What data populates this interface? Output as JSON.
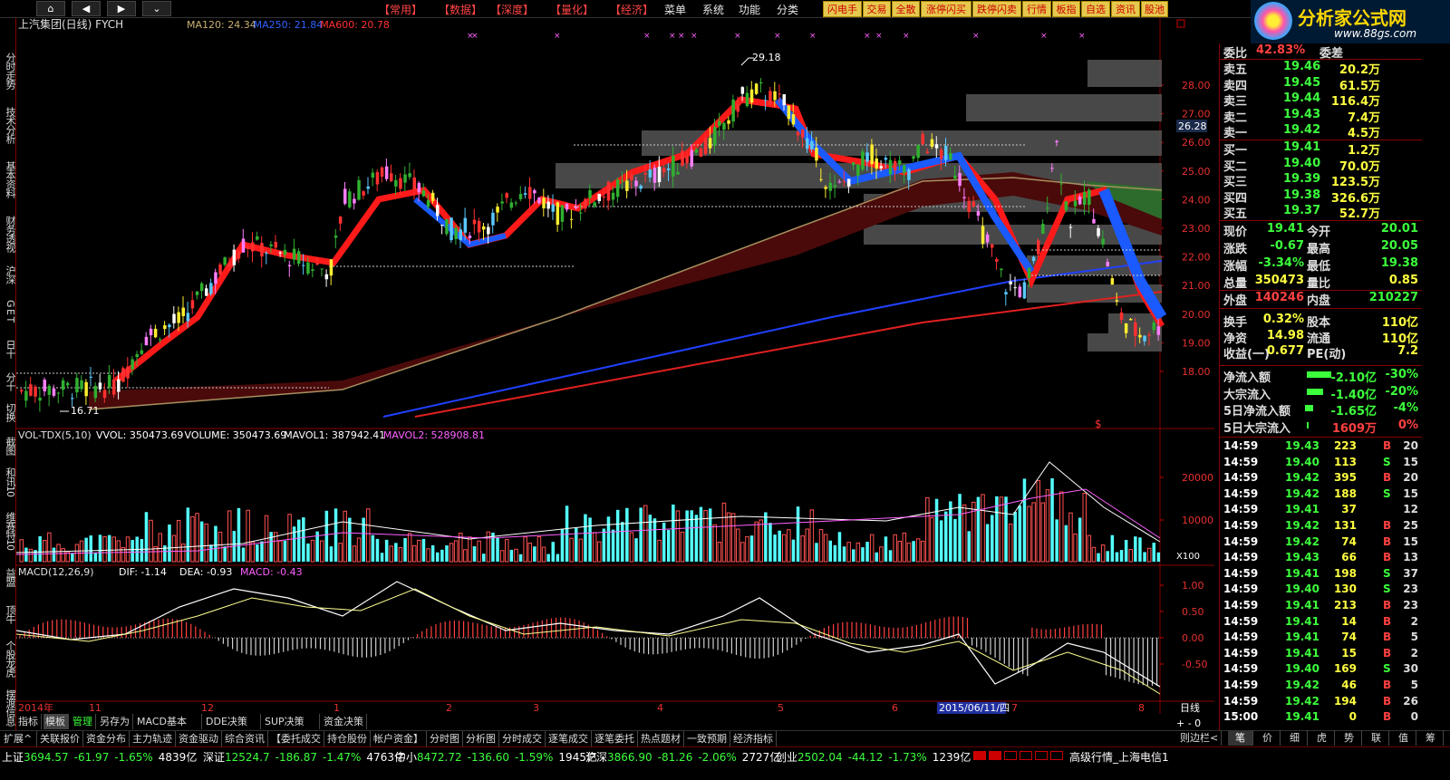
{
  "topmenu": {
    "nav": [
      "⌂",
      "◀",
      "▶",
      "⌄"
    ],
    "items": [
      "【常用】",
      "【数据】",
      "【深度】",
      "【量化】",
      "【经济】",
      "菜单",
      "系统",
      "功能",
      "分类"
    ],
    "tools": [
      "闪电手",
      "交易",
      "全散",
      "涨停闪买",
      "跌停闪卖",
      "行情",
      "板指",
      "自选",
      "资讯",
      "股池"
    ]
  },
  "logo": {
    "text": "分析家公式网",
    "url": "www.88gs.com"
  },
  "chart": {
    "title": "上汽集团(日线) FYCH",
    "ma": [
      {
        "label": "MA120: 24.34",
        "color": "#c8b070"
      },
      {
        "label": "MA250: 21.84",
        "color": "#3060ff"
      },
      {
        "label": "MA600: 20.78",
        "color": "#ff3030"
      }
    ],
    "price_labels": [
      "28.00",
      "27.00",
      "26.00",
      "25.00",
      "24.00",
      "23.00",
      "22.00",
      "21.00",
      "20.00",
      "19.00",
      "18.00"
    ],
    "current_price_tag": "26.28",
    "high_mark": "29.18",
    "low_mark": "16.71",
    "vol_title": "VOL-TDX(5,10)",
    "vol_vals": [
      {
        "label": "VVOL: 350473.69",
        "color": "#ffffff"
      },
      {
        "label": "VOLUME: 350473.69",
        "color": "#ffffff"
      },
      {
        "label": "MAVOL1: 387942.41",
        "color": "#ffffff"
      },
      {
        "label": "MAVOL2: 528908.81",
        "color": "#ff60ff"
      }
    ],
    "vol_labels": [
      "20000",
      "10000"
    ],
    "vol_unit": "X100",
    "macd_title": "MACD(12,26,9)",
    "macd_vals": [
      {
        "label": "DIF: -1.14",
        "color": "#ffffff"
      },
      {
        "label": "DEA: -0.93",
        "color": "#ffffff"
      },
      {
        "label": "MACD: -0.43",
        "color": "#ff60ff"
      }
    ],
    "macd_labels": [
      "1.00",
      "0.50",
      "0.00",
      "-0.50"
    ],
    "dates": [
      "2014年",
      "11",
      "12",
      "1",
      "2",
      "3",
      "4",
      "5",
      "6",
      "7",
      "8"
    ],
    "cursor_date": "2015/06/11/四",
    "period": "日线",
    "dollar": "$"
  },
  "leftbar": [
    "分时走势",
    "技术分析",
    "基本资料",
    "财务透视",
    "沪深",
    "G E T",
    "日十",
    "分十",
    "切换",
    "截图",
    "和讯10",
    "维赛特10",
    "益盟",
    "顶牛",
    "个股龙虎",
    "摆渡信息"
  ],
  "quote": {
    "weibi_label": "委比",
    "weibi_val": "42.83%",
    "weicha_label": "委差",
    "asks": [
      {
        "l": "卖五",
        "p": "19.46",
        "v": "20.2万"
      },
      {
        "l": "卖四",
        "p": "19.45",
        "v": "61.5万"
      },
      {
        "l": "卖三",
        "p": "19.44",
        "v": "116.4万"
      },
      {
        "l": "卖二",
        "p": "19.43",
        "v": "7.4万"
      },
      {
        "l": "卖一",
        "p": "19.42",
        "v": "4.5万"
      }
    ],
    "bids": [
      {
        "l": "买一",
        "p": "19.41",
        "v": "1.2万"
      },
      {
        "l": "买二",
        "p": "19.40",
        "v": "70.0万"
      },
      {
        "l": "买三",
        "p": "19.39",
        "v": "123.5万"
      },
      {
        "l": "买四",
        "p": "19.38",
        "v": "326.6万"
      },
      {
        "l": "买五",
        "p": "19.37",
        "v": "52.7万"
      }
    ],
    "stats": [
      {
        "a": "现价",
        "av": "19.41",
        "ac": "green",
        "b": "今开",
        "bv": "20.01",
        "bc": "green"
      },
      {
        "a": "涨跌",
        "av": "-0.67",
        "ac": "green",
        "b": "最高",
        "bv": "20.05",
        "bc": "green"
      },
      {
        "a": "涨幅",
        "av": "-3.34%",
        "ac": "green",
        "b": "最低",
        "bv": "19.38",
        "bc": "green"
      },
      {
        "a": "总量",
        "av": "350473",
        "ac": "yellow",
        "b": "量比",
        "bv": "0.85",
        "bc": "yellow"
      },
      {
        "a": "外盘",
        "av": "140246",
        "ac": "red",
        "b": "内盘",
        "bv": "210227",
        "bc": "green"
      },
      {
        "a": "换手",
        "av": "0.32%",
        "ac": "yellow",
        "b": "股本",
        "bv": "110亿",
        "bc": "yellow"
      },
      {
        "a": "净资",
        "av": "14.98",
        "ac": "yellow",
        "b": "流通",
        "bv": "110亿",
        "bc": "yellow"
      },
      {
        "a": "收益(一)",
        "av": "0.677",
        "ac": "yellow",
        "b": "PE(动)",
        "bv": "7.2",
        "bc": "yellow"
      }
    ],
    "flows": [
      {
        "l": "净流入额",
        "v": "-2.10亿",
        "p": "-30%",
        "bar": 0.3
      },
      {
        "l": "大宗流入",
        "v": "-1.40亿",
        "p": "-20%",
        "bar": 0.2
      },
      {
        "l": "5日净流入额",
        "v": "-1.65亿",
        "p": "-4%",
        "bar": 0.1
      },
      {
        "l": "5日大宗流入",
        "v": "1609万",
        "p": "0%",
        "bar": 0
      }
    ],
    "ticks": [
      {
        "t": "14:59",
        "p": "19.43",
        "v": "223",
        "d": "B",
        "n": "20"
      },
      {
        "t": "14:59",
        "p": "19.40",
        "v": "113",
        "d": "S",
        "n": "15"
      },
      {
        "t": "14:59",
        "p": "19.42",
        "v": "395",
        "d": "B",
        "n": "20"
      },
      {
        "t": "14:59",
        "p": "19.42",
        "v": "188",
        "d": "S",
        "n": "15"
      },
      {
        "t": "14:59",
        "p": "19.41",
        "v": "37",
        "d": "",
        "n": "12"
      },
      {
        "t": "14:59",
        "p": "19.42",
        "v": "131",
        "d": "B",
        "n": "25"
      },
      {
        "t": "14:59",
        "p": "19.42",
        "v": "74",
        "d": "B",
        "n": "15"
      },
      {
        "t": "14:59",
        "p": "19.43",
        "v": "66",
        "d": "B",
        "n": "13"
      },
      {
        "t": "14:59",
        "p": "19.41",
        "v": "198",
        "d": "S",
        "n": "37"
      },
      {
        "t": "14:59",
        "p": "19.40",
        "v": "130",
        "d": "S",
        "n": "23"
      },
      {
        "t": "14:59",
        "p": "19.41",
        "v": "213",
        "d": "B",
        "n": "23"
      },
      {
        "t": "14:59",
        "p": "19.41",
        "v": "14",
        "d": "B",
        "n": "2"
      },
      {
        "t": "14:59",
        "p": "19.41",
        "v": "74",
        "d": "B",
        "n": "5"
      },
      {
        "t": "14:59",
        "p": "19.41",
        "v": "15",
        "d": "B",
        "n": "2"
      },
      {
        "t": "14:59",
        "p": "19.40",
        "v": "169",
        "d": "S",
        "n": "30"
      },
      {
        "t": "14:59",
        "p": "19.42",
        "v": "46",
        "d": "B",
        "n": "5"
      },
      {
        "t": "14:59",
        "p": "19.42",
        "v": "194",
        "d": "B",
        "n": "26"
      },
      {
        "t": "15:00",
        "p": "19.41",
        "v": "0",
        "d": "B",
        "n": "0"
      }
    ]
  },
  "bottomtabs": [
    "指标",
    "模板",
    "管理",
    "另存为",
    "MACD基本",
    "DDE决策",
    "SUP决策",
    "资金决策"
  ],
  "bottomtabs2": [
    "扩展^",
    "关联报价",
    "资金分布",
    "主力轨迹",
    "资金驱动",
    "综合资讯",
    "【委托成交",
    "持仓股份",
    "帐户资金】",
    "分时图",
    "分析图",
    "分时成交",
    "逐笔成交",
    "逐笔委托",
    "热点题材",
    "一致预期",
    "经济指标"
  ],
  "bottomright": [
    "笔",
    "价",
    "细",
    "虎",
    "势",
    "联",
    "值",
    "筹"
  ],
  "bottomright_label": "则边栏<",
  "statusbar": [
    {
      "n": "上证",
      "v": "3694.57",
      "c": "-61.97",
      "p": "-1.65%",
      "a": "4839亿"
    },
    {
      "n": "深证",
      "v": "12524.7",
      "c": "-186.87",
      "p": "-1.47%",
      "a": "4763亿"
    },
    {
      "n": "中小",
      "v": "8472.72",
      "c": "-136.60",
      "p": "-1.59%",
      "a": "1945亿"
    },
    {
      "n": "沪深",
      "v": "3866.90",
      "c": "-81.26",
      "p": "-2.06%",
      "a": "2727亿"
    },
    {
      "n": "创业",
      "v": "2502.04",
      "c": "-44.12",
      "p": "-1.73%",
      "a": "1239亿"
    }
  ],
  "status_right": "高级行情_上海电信1"
}
